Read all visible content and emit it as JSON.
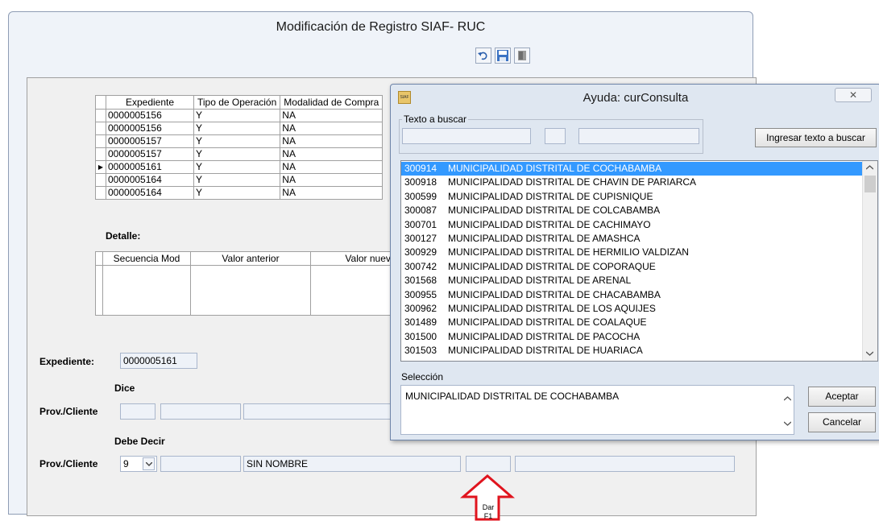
{
  "main": {
    "title": "Modificación de Registro SIAF- RUC",
    "grid_headers": [
      "Expediente",
      "Tipo de Operación",
      "Modalidad de Compra"
    ],
    "grid_rows": [
      {
        "exp": "0000005156",
        "tipo": "Y",
        "mod": "NA",
        "current": false
      },
      {
        "exp": "0000005156",
        "tipo": "Y",
        "mod": "NA",
        "current": false
      },
      {
        "exp": "0000005157",
        "tipo": "Y",
        "mod": "NA",
        "current": false
      },
      {
        "exp": "0000005157",
        "tipo": "Y",
        "mod": "NA",
        "current": false
      },
      {
        "exp": "0000005161",
        "tipo": "Y",
        "mod": "NA",
        "current": true
      },
      {
        "exp": "0000005164",
        "tipo": "Y",
        "mod": "NA",
        "current": false
      },
      {
        "exp": "0000005164",
        "tipo": "Y",
        "mod": "NA",
        "current": false
      }
    ],
    "detalle_label": "Detalle:",
    "detalle_headers": [
      "Secuencia Mod",
      "Valor anterior",
      "Valor nuevo"
    ],
    "expediente_label": "Expediente:",
    "expediente_value": "0000005161",
    "dice_label": "Dice",
    "prov_label": "Prov./Cliente",
    "debe_decir_label": "Debe Decir",
    "prov2_label": "Prov./Cliente",
    "prov2_combo_value": "9",
    "prov2_name": "SIN NOMBRE",
    "arrow_text_line1": "Dar",
    "arrow_text_line2": "F1"
  },
  "dialog": {
    "app_icon_text": "SIAF",
    "title": "Ayuda: curConsulta",
    "close_glyph": "✕",
    "search_group_label": "Texto a buscar",
    "search_button": "Ingresar texto a buscar",
    "items": [
      {
        "code": "300914",
        "name": "MUNICIPALIDAD DISTRITAL DE COCHABAMBA",
        "selected": true
      },
      {
        "code": "300918",
        "name": "MUNICIPALIDAD DISTRITAL DE CHAVIN DE PARIARCA",
        "selected": false
      },
      {
        "code": "300599",
        "name": "MUNICIPALIDAD DISTRITAL DE CUPISNIQUE",
        "selected": false
      },
      {
        "code": "300087",
        "name": "MUNICIPALIDAD DISTRITAL DE COLCABAMBA",
        "selected": false
      },
      {
        "code": "300701",
        "name": "MUNICIPALIDAD DISTRITAL DE CACHIMAYO",
        "selected": false
      },
      {
        "code": "300127",
        "name": "MUNICIPALIDAD DISTRITAL DE AMASHCA",
        "selected": false
      },
      {
        "code": "300929",
        "name": "MUNICIPALIDAD DISTRITAL DE HERMILIO VALDIZAN",
        "selected": false
      },
      {
        "code": "300742",
        "name": "MUNICIPALIDAD DISTRITAL DE COPORAQUE",
        "selected": false
      },
      {
        "code": "301568",
        "name": "MUNICIPALIDAD DISTRITAL DE ARENAL",
        "selected": false
      },
      {
        "code": "300955",
        "name": "MUNICIPALIDAD DISTRITAL DE CHACABAMBA",
        "selected": false
      },
      {
        "code": "300962",
        "name": "MUNICIPALIDAD DISTRITAL DE LOS AQUIJES",
        "selected": false
      },
      {
        "code": "301489",
        "name": "MUNICIPALIDAD DISTRITAL DE COALAQUE",
        "selected": false
      },
      {
        "code": "301500",
        "name": "MUNICIPALIDAD DISTRITAL DE PACOCHA",
        "selected": false
      },
      {
        "code": "301503",
        "name": "MUNICIPALIDAD DISTRITAL DE HUARIACA",
        "selected": false
      }
    ],
    "seleccion_label": "Selección",
    "seleccion_value": "MUNICIPALIDAD DISTRITAL DE COCHABAMBA",
    "accept_button": "Aceptar",
    "cancel_button": "Cancelar"
  },
  "colors": {
    "selection": "#3399ff",
    "arrow": "#e0141e",
    "dialog_bg": "#dfe7f1"
  }
}
